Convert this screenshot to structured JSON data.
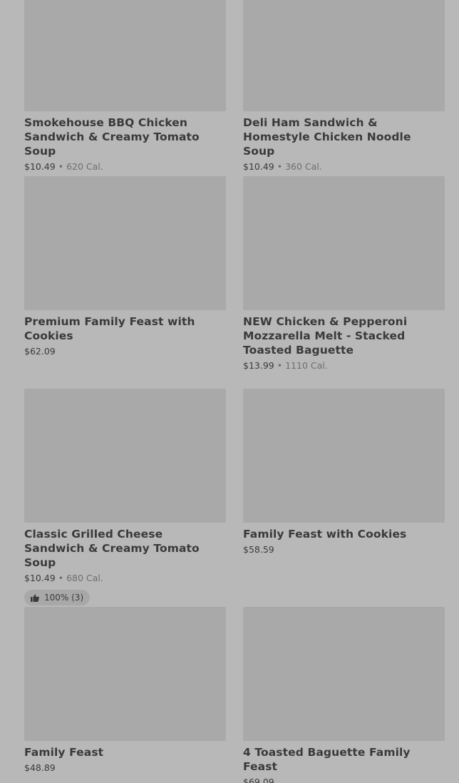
{
  "items": [
    {
      "title": "Smokehouse BBQ Chicken Sandwich & Creamy Tomato Soup",
      "price": "$10.49",
      "separator": "•",
      "calories": "620 Cal."
    },
    {
      "title": "Deli Ham Sandwich & Homestyle Chicken Noodle Soup",
      "price": "$10.49",
      "separator": "•",
      "calories": "360 Cal."
    },
    {
      "title": "Premium Family Feast with Cookies",
      "price": "$62.09"
    },
    {
      "title": "NEW Chicken & Pepperoni Mozzarella Melt - Stacked Toasted Baguette",
      "price": "$13.99",
      "separator": "•",
      "calories": "1110 Cal."
    },
    {
      "title": "Classic Grilled Cheese Sandwich & Creamy Tomato Soup",
      "price": "$10.49",
      "separator": "•",
      "calories": "680 Cal.",
      "rating": "100% (3)",
      "rating_icon": "thumbs-up-icon"
    },
    {
      "title": "Family Feast with Cookies",
      "price": "$58.59"
    },
    {
      "title": "Family Feast",
      "price": "$48.89"
    },
    {
      "title": "4 Toasted Baguette Family Feast",
      "price": "$69.09"
    }
  ]
}
